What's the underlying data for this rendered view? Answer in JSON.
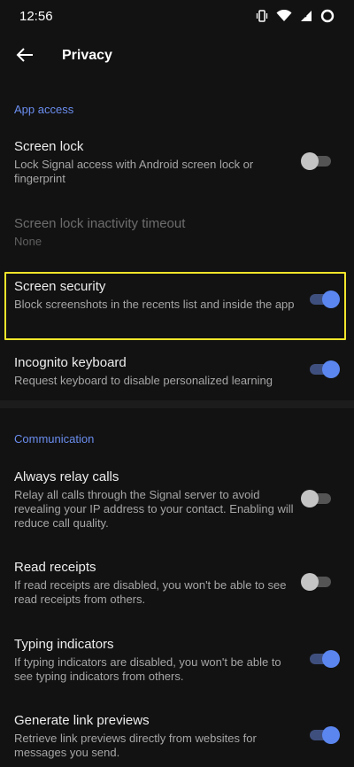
{
  "status_bar": {
    "time": "12:56",
    "icons": [
      "vibrate-icon",
      "wifi-icon",
      "signal-icon",
      "battery-icon"
    ]
  },
  "header": {
    "title": "Privacy",
    "back_icon": "arrow-left-icon"
  },
  "sections": {
    "app_access": {
      "label": "App access"
    },
    "communication": {
      "label": "Communication"
    }
  },
  "settings": {
    "screen_lock": {
      "title": "Screen lock",
      "summary": "Lock Signal access with Android screen lock or fingerprint",
      "enabled": false
    },
    "screen_lock_timeout": {
      "title": "Screen lock inactivity timeout",
      "summary": "None"
    },
    "screen_security": {
      "title": "Screen security",
      "summary": "Block screenshots in the recents list and inside the app",
      "enabled": true
    },
    "incognito_keyboard": {
      "title": "Incognito keyboard",
      "summary": "Request keyboard to disable personalized learning",
      "enabled": true
    },
    "always_relay_calls": {
      "title": "Always relay calls",
      "summary": "Relay all calls through the Signal server to avoid revealing your IP address to your contact. Enabling will reduce call quality.",
      "enabled": false
    },
    "read_receipts": {
      "title": "Read receipts",
      "summary": "If read receipts are disabled, you won't be able to see read receipts from others.",
      "enabled": false
    },
    "typing_indicators": {
      "title": "Typing indicators",
      "summary": "If typing indicators are disabled, you won't be able to see typing indicators from others.",
      "enabled": true
    },
    "link_previews": {
      "title": "Generate link previews",
      "summary": "Retrieve link previews directly from websites for messages you send.",
      "enabled": true
    }
  },
  "colors": {
    "background": "#121212",
    "accent": "#5b86ef",
    "highlight": "#f2e52a"
  }
}
